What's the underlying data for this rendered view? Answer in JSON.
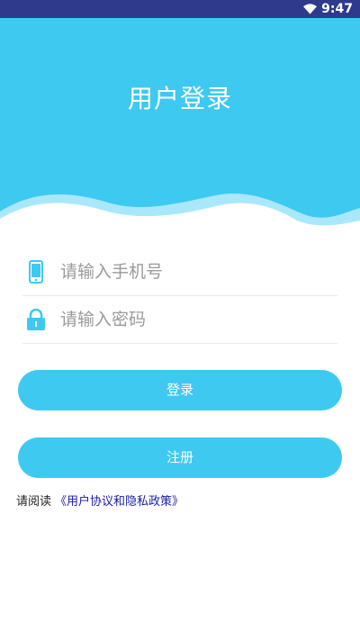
{
  "status_bar": {
    "time": "9:47",
    "background": "#2f3a8c",
    "icons": [
      "wifi-icon"
    ]
  },
  "header": {
    "title": "用户登录",
    "background": "#3ec9f1"
  },
  "form": {
    "phone": {
      "placeholder": "请输入手机号",
      "value": "",
      "icon": "phone-icon"
    },
    "password": {
      "placeholder": "请输入密码",
      "value": "",
      "icon": "lock-icon"
    }
  },
  "buttons": {
    "login_label": "登录",
    "register_label": "注册",
    "color": "#3ec9f1"
  },
  "agreement": {
    "prefix": "请阅读",
    "link": "《用户协议和隐私政策》",
    "link_color": "#1a1aa8"
  }
}
